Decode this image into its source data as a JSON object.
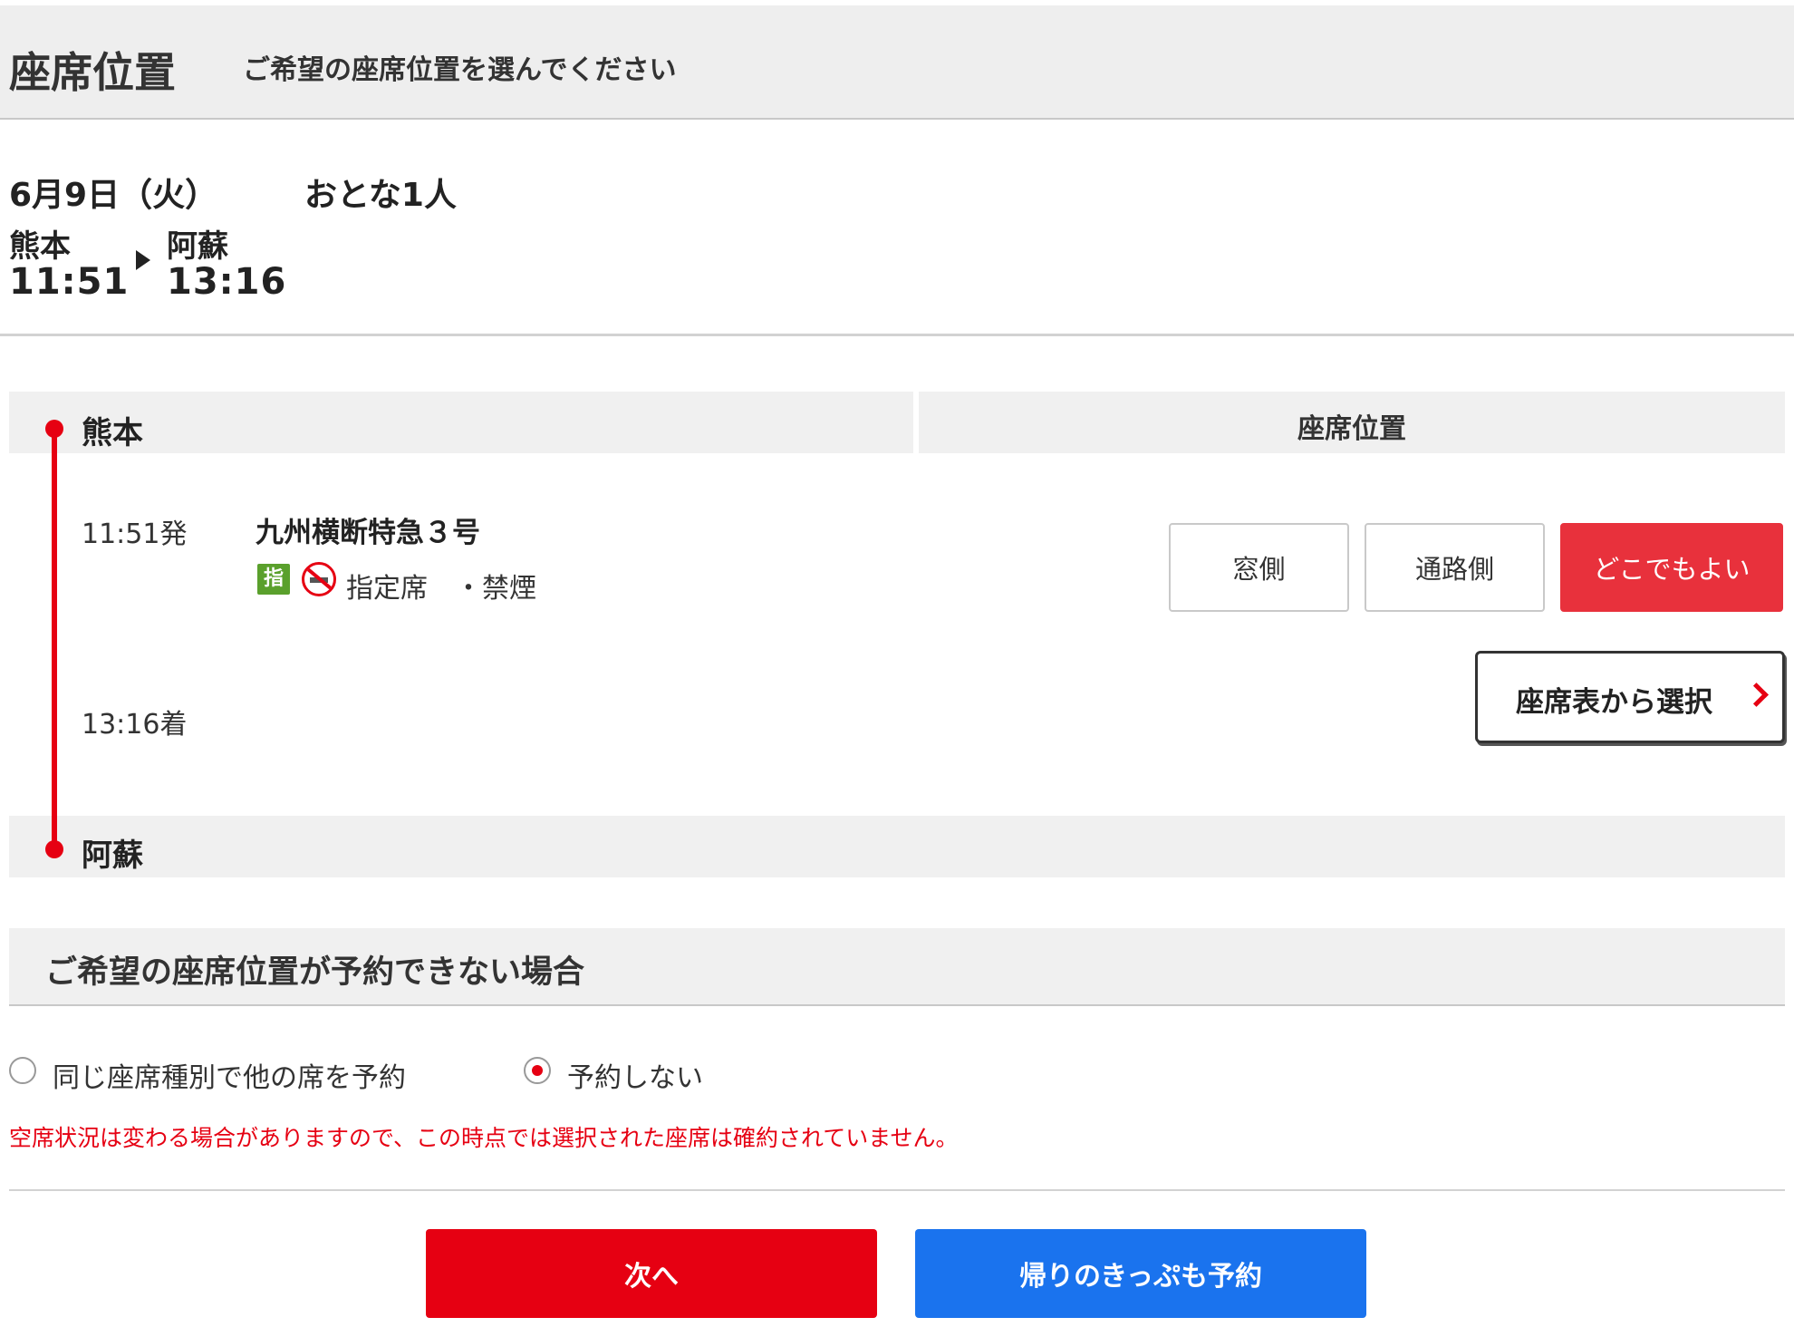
{
  "header": {
    "title": "座席位置",
    "subtitle": "ご希望の座席位置を選んでください"
  },
  "trip": {
    "date": "6月9日（火）",
    "passengers": "おとな1人",
    "from": {
      "station": "熊本",
      "time": "11:51"
    },
    "to": {
      "station": "阿蘇",
      "time": "13:16"
    }
  },
  "segment": {
    "departure_station": "熊本",
    "arrival_station": "阿蘇",
    "seat_column_title": "座席位置",
    "departure_time": "11:51発",
    "arrival_time": "13:16着",
    "train_name": "九州横断特急３号",
    "reserved_icon_label": "指",
    "seat_type": "指定席　・禁煙",
    "icons": [
      "reserved-seat-icon",
      "no-smoking-icon"
    ],
    "seat_options": [
      {
        "label": "窓側",
        "selected": false
      },
      {
        "label": "通路側",
        "selected": false
      },
      {
        "label": "どこでもよい",
        "selected": true
      }
    ],
    "seat_map_button": "座席表から選択"
  },
  "fallback": {
    "title": "ご希望の座席位置が予約できない場合",
    "options": [
      {
        "label": "同じ座席種別で他の席を予約",
        "checked": false
      },
      {
        "label": "予約しない",
        "checked": true
      }
    ],
    "notice": "空席状況は変わる場合がありますので、この時点では選択された座席は確約されていません。"
  },
  "actions": {
    "next": "次へ",
    "return_ticket": "帰りのきっぷも予約"
  },
  "colors": {
    "accent_red": "#e60012",
    "selected_red": "#e8313c",
    "action_blue": "#1a73ee",
    "reserved_green": "#5aa02c"
  }
}
